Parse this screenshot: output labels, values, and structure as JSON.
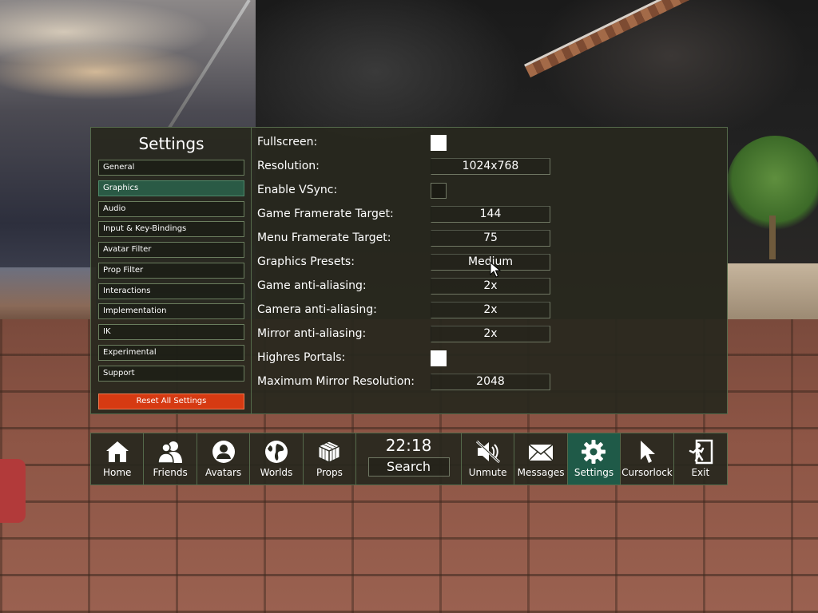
{
  "settings": {
    "title": "Settings",
    "nav": [
      {
        "label": "General"
      },
      {
        "label": "Graphics"
      },
      {
        "label": "Audio"
      },
      {
        "label": "Input & Key-Bindings"
      },
      {
        "label": "Avatar Filter"
      },
      {
        "label": "Prop Filter"
      },
      {
        "label": "Interactions"
      },
      {
        "label": "Implementation"
      },
      {
        "label": "IK"
      },
      {
        "label": "Experimental"
      },
      {
        "label": "Support"
      }
    ],
    "active_nav": "Graphics",
    "reset_label": "Reset All Settings",
    "rows": {
      "fullscreen": {
        "label": "Fullscreen:",
        "checked": true
      },
      "resolution": {
        "label": "Resolution:",
        "value": "1024x768"
      },
      "vsync": {
        "label": "Enable VSync:",
        "checked": false
      },
      "game_framerate": {
        "label": "Game Framerate Target:",
        "value": "144"
      },
      "menu_framerate": {
        "label": "Menu Framerate Target:",
        "value": "75"
      },
      "graphics_presets": {
        "label": "Graphics Presets:",
        "value": "Medium"
      },
      "game_aa": {
        "label": "Game anti-aliasing:",
        "value": "2x"
      },
      "camera_aa": {
        "label": "Camera anti-aliasing:",
        "value": "2x"
      },
      "mirror_aa": {
        "label": "Mirror anti-aliasing:",
        "value": "2x"
      },
      "highres_portals": {
        "label": "Highres Portals:",
        "checked": true
      },
      "mirror_resolution": {
        "label": "Maximum Mirror Resolution:",
        "value": "2048"
      }
    }
  },
  "dock": {
    "home": {
      "label": "Home",
      "icon": "home-icon"
    },
    "friends": {
      "label": "Friends",
      "icon": "friends-icon"
    },
    "avatars": {
      "label": "Avatars",
      "icon": "avatar-icon"
    },
    "worlds": {
      "label": "Worlds",
      "icon": "globe-icon"
    },
    "props": {
      "label": "Props",
      "icon": "cube-icon"
    },
    "clock": "22:18",
    "search": "Search",
    "unmute": {
      "label": "Unmute",
      "icon": "muted-speaker-icon"
    },
    "messages": {
      "label": "Messages",
      "icon": "envelope-icon"
    },
    "settings": {
      "label": "Settings",
      "icon": "gear-icon"
    },
    "cursorlock": {
      "label": "Cursorlock",
      "icon": "cursor-icon"
    },
    "exit": {
      "label": "Exit",
      "icon": "exit-icon"
    },
    "active": "settings"
  },
  "colors": {
    "panel_bg": "#28281e",
    "panel_border": "#556a4b",
    "active_green": "#2a5a45",
    "reset_red": "#d63a12"
  }
}
